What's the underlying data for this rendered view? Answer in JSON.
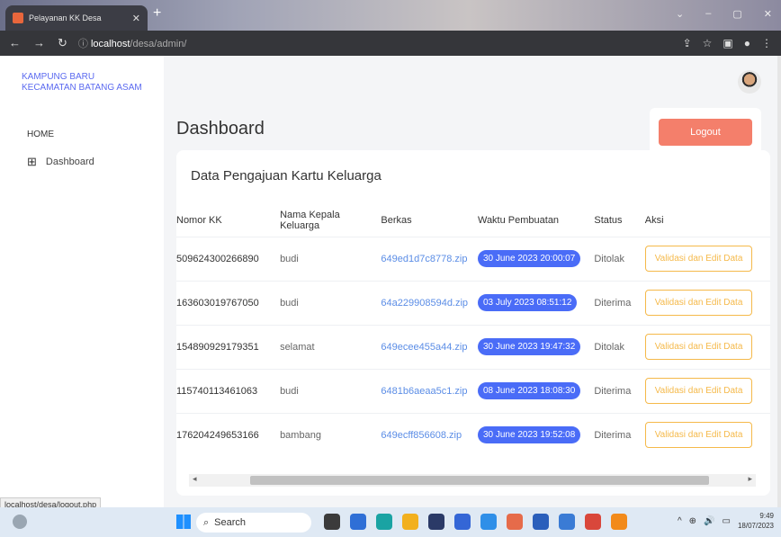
{
  "browser": {
    "tab_title": "Pelayanan KK Desa",
    "url_host": "localhost",
    "url_path": "/desa/admin/",
    "status_url": "localhost/desa/logout.php"
  },
  "sidebar": {
    "brand_line1": "KAMPUNG BARU",
    "brand_line2": "KECAMATAN BATANG ASAM",
    "section": "HOME",
    "items": [
      {
        "label": "Dashboard"
      }
    ]
  },
  "header": {
    "page_title": "Dashboard",
    "logout_label": "Logout"
  },
  "card": {
    "title": "Data Pengajuan Kartu Keluarga",
    "columns": [
      "Nomor KK",
      "Nama Kepala Keluarga",
      "Berkas",
      "Waktu Pembuatan",
      "Status",
      "Aksi"
    ],
    "rows": [
      {
        "kk": "509624300266890",
        "nama": "budi",
        "berkas": "649ed1d7c8778.zip",
        "waktu": "30 June 2023 20:00:07",
        "status": "Ditolak",
        "aksi": "Validasi dan Edit Data"
      },
      {
        "kk": "163603019767050",
        "nama": "budi",
        "berkas": "64a229908594d.zip",
        "waktu": "03 July 2023 08:51:12",
        "status": "Diterima",
        "aksi": "Validasi dan Edit Data"
      },
      {
        "kk": "154890929179351",
        "nama": "selamat",
        "berkas": "649ecee455a44.zip",
        "waktu": "30 June 2023 19:47:32",
        "status": "Ditolak",
        "aksi": "Validasi dan Edit Data"
      },
      {
        "kk": "115740113461063",
        "nama": "budi",
        "berkas": "6481b6aeaa5c1.zip",
        "waktu": "08 June 2023 18:08:30",
        "status": "Diterima",
        "aksi": "Validasi dan Edit Data"
      },
      {
        "kk": "176204249653166",
        "nama": "bambang",
        "berkas": "649ecff856608.zip",
        "waktu": "30 June 2023 19:52:08",
        "status": "Diterima",
        "aksi": "Validasi dan Edit Data"
      }
    ]
  },
  "taskbar": {
    "search_label": "Search",
    "time": "9:49",
    "date": "18/07/2023",
    "app_colors": [
      "#3b3b3b",
      "#2f6fd6",
      "#1aa3a3",
      "#f2b01e",
      "#2b3a67",
      "#3466d6",
      "#2f8fe8",
      "#e66b4a",
      "#2b5fbb",
      "#3a7bd5",
      "#d9473b",
      "#f28a1a"
    ]
  }
}
